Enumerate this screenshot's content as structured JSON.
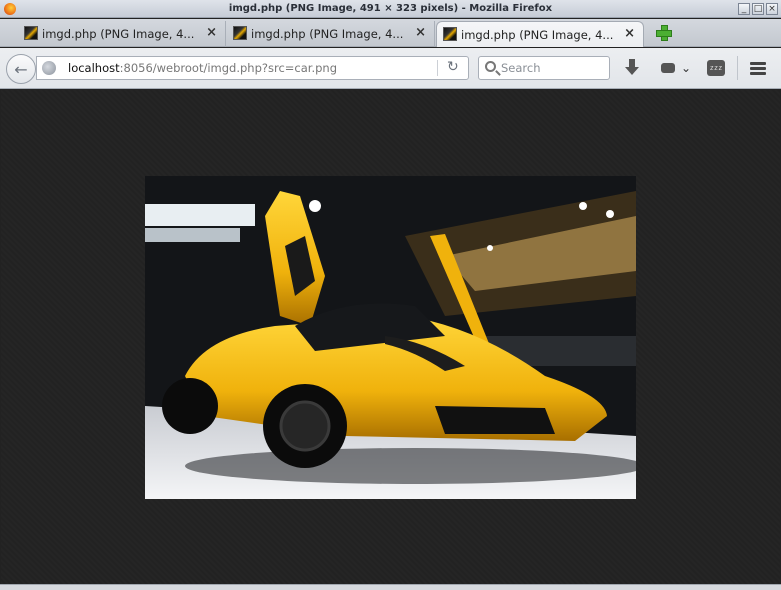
{
  "window": {
    "title": "imgd.php (PNG Image, 491 × 323 pixels) - Mozilla Firefox",
    "buttons": {
      "minimize": "_",
      "maximize": "□",
      "close": "×"
    }
  },
  "tabs": [
    {
      "label": "imgd.php (PNG Image, 4...",
      "active": false
    },
    {
      "label": "imgd.php (PNG Image, 4...",
      "active": false
    },
    {
      "label": "imgd.php (PNG Image, 4...",
      "active": true
    }
  ],
  "tab_close_glyph": "×",
  "navbar": {
    "back_glyph": "←",
    "url_host": "localhost",
    "url_rest": ":8056/webroot/imgd.php?src=car.png",
    "reload_glyph": "↻",
    "search_placeholder": "Search",
    "addon_chevron": "⌄",
    "sleep_label": "zzz"
  },
  "image": {
    "colors": {
      "car": "#f2b70f",
      "floor": "#eef0f3",
      "ceiling": "#151719"
    }
  }
}
